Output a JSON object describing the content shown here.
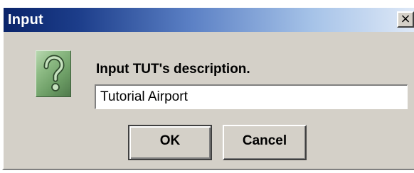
{
  "window": {
    "title": "Input",
    "close_glyph": "×"
  },
  "dialog": {
    "icon": "question-icon",
    "message": "Input TUT's description.",
    "input_value": "Tutorial Airport",
    "ok_label": "OK",
    "cancel_label": "Cancel"
  },
  "colors": {
    "title_gradient_start": "#0a246a",
    "title_gradient_end": "#dfe9f7",
    "dialog_bg": "#d4d0c8",
    "icon_green": "#8fbc86"
  }
}
